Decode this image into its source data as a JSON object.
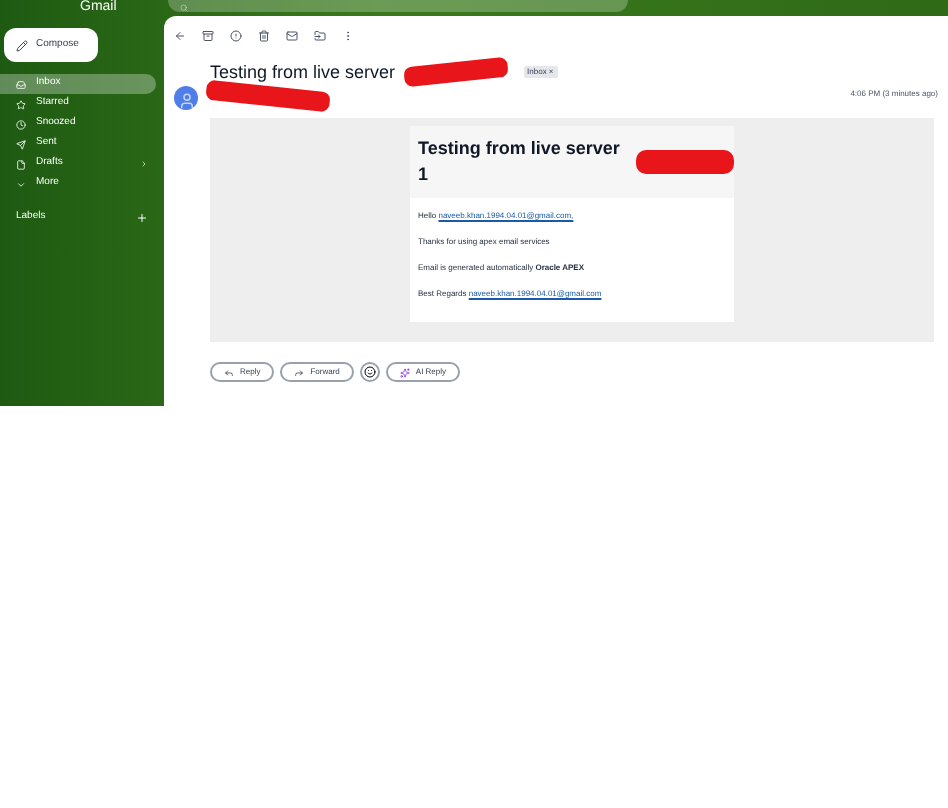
{
  "app": {
    "name": "Gmail"
  },
  "compose": {
    "label": "Compose"
  },
  "sidebar": {
    "items": [
      {
        "label": "Inbox",
        "selected": true,
        "kind": "inbox"
      },
      {
        "label": "Starred",
        "selected": false,
        "kind": "star"
      },
      {
        "label": "Snoozed",
        "selected": false,
        "kind": "clock"
      },
      {
        "label": "Sent",
        "selected": false,
        "kind": "send"
      },
      {
        "label": "Drafts",
        "selected": false,
        "kind": "draft"
      },
      {
        "label": "More",
        "selected": false,
        "kind": "more"
      }
    ],
    "labels_heading": "Labels"
  },
  "email": {
    "subject": "Testing from live server",
    "tag": "Inbox ×",
    "time": "4:06 PM (3 minutes ago)",
    "heading": "Testing from live server 1",
    "lines": [
      {
        "text": "Hello ",
        "link": "naveeb.khan.1994.04.01@gmail.com,"
      },
      {
        "text": "Thanks for using apex email services"
      },
      {
        "text": "Email is generated automatically **Oracle APEX**"
      },
      {
        "text": "Best Regards ",
        "link": "naveeb.khan.1994.04.01@gmail.com"
      }
    ]
  },
  "actions": [
    {
      "label": "Reply",
      "kind": "reply"
    },
    {
      "label": "Forward",
      "kind": "forward"
    },
    {
      "kind": "emoji"
    },
    {
      "label": "AI Reply",
      "kind": "ai"
    }
  ]
}
